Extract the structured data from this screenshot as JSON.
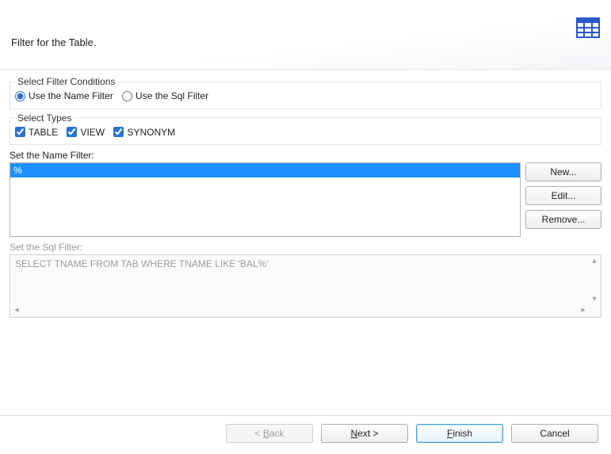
{
  "header": {
    "title": "Filter for the Table."
  },
  "filterConditions": {
    "legend": "Select Filter Conditions",
    "nameFilter": {
      "label": "Use the Name Filter",
      "checked": true
    },
    "sqlFilter": {
      "label": "Use the Sql Filter",
      "checked": false
    }
  },
  "types": {
    "legend": "Select Types",
    "table": {
      "label": "TABLE",
      "checked": true
    },
    "view": {
      "label": "VIEW",
      "checked": true
    },
    "synonym": {
      "label": "SYNONYM",
      "checked": true
    }
  },
  "nameFilterSection": {
    "label": "Set the Name Filter:",
    "items": [
      "%"
    ],
    "selectedIndex": 0,
    "buttons": {
      "new": "New...",
      "edit": "Edit...",
      "remove": "Remove..."
    }
  },
  "sqlFilterSection": {
    "label": "Set the Sql Filter:",
    "text": "SELECT TNAME FROM TAB WHERE TNAME LIKE 'BAL%'",
    "enabled": false
  },
  "footer": {
    "back": {
      "pre": "< ",
      "mn": "B",
      "post": "ack",
      "enabled": false
    },
    "next": {
      "pre": "",
      "mn": "N",
      "post": "ext >",
      "enabled": true
    },
    "finish": {
      "pre": "",
      "mn": "F",
      "post": "inish",
      "enabled": true,
      "primary": true
    },
    "cancel": {
      "label": "Cancel",
      "enabled": true
    }
  }
}
